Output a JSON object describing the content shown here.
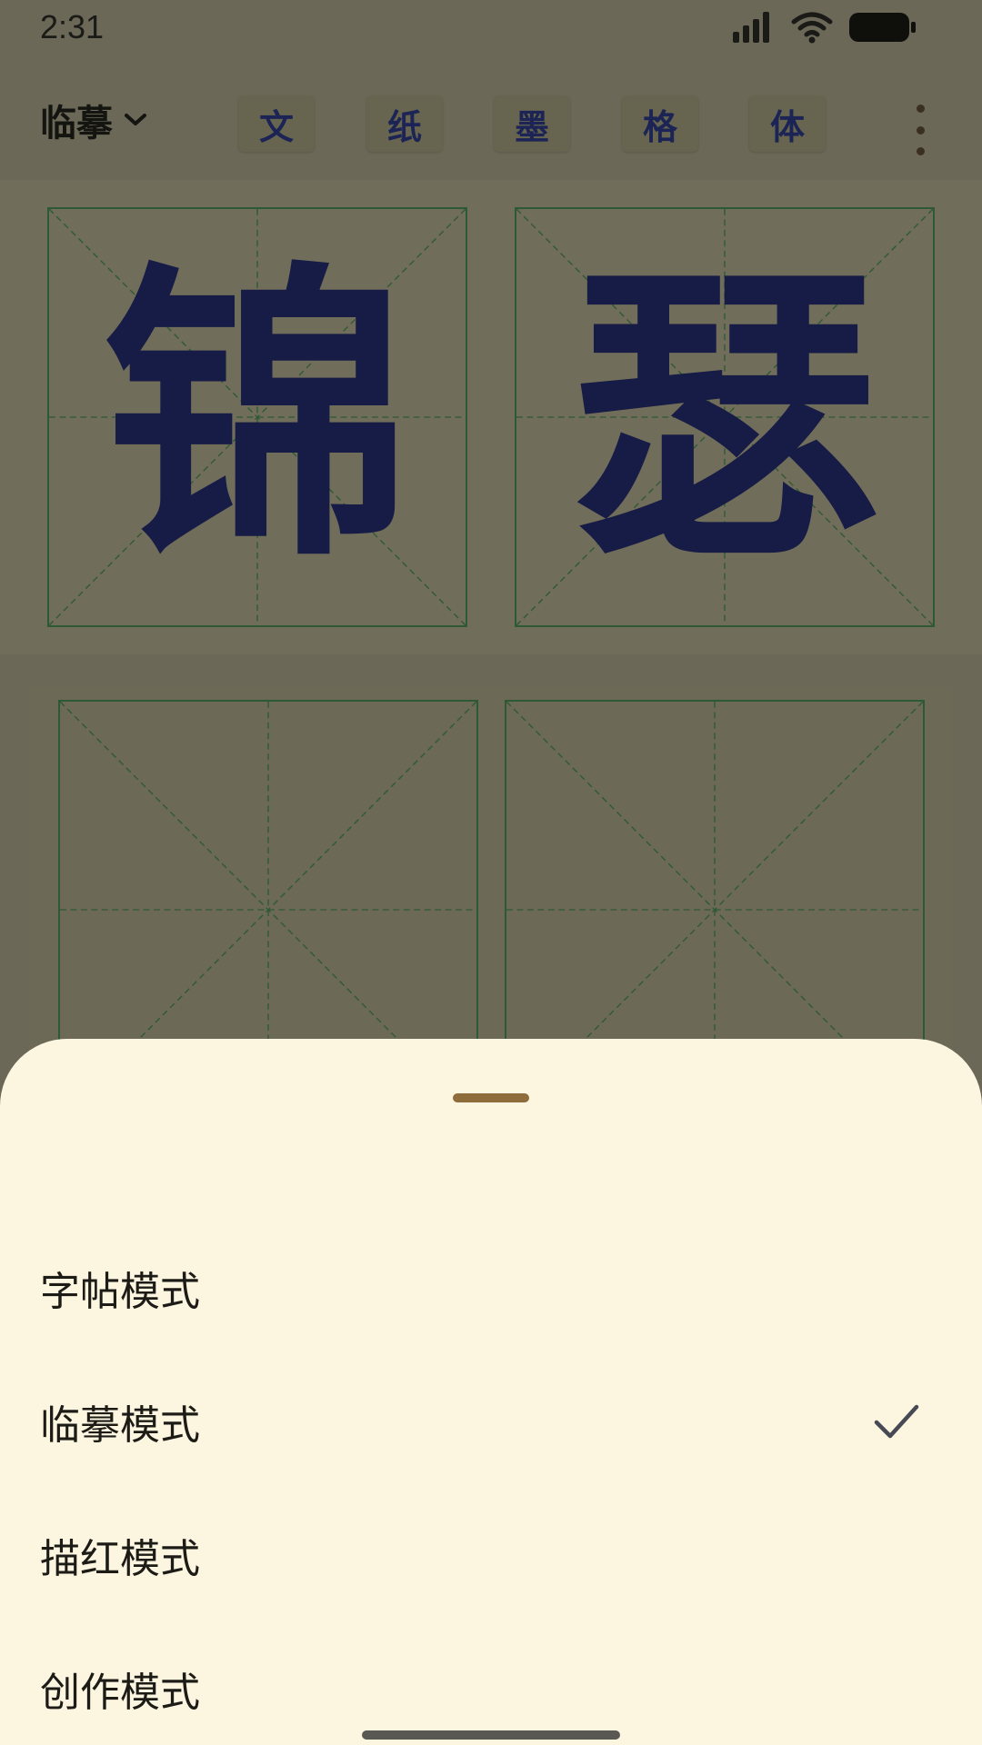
{
  "status_bar": {
    "time": "2:31"
  },
  "toolbar": {
    "mode_label": "临摹",
    "tools": [
      "文",
      "纸",
      "墨",
      "格",
      "体"
    ]
  },
  "reference": {
    "characters": [
      "锦",
      "瑟"
    ]
  },
  "sheet": {
    "items": [
      {
        "label": "字帖模式",
        "selected": false
      },
      {
        "label": "临摹模式",
        "selected": true
      },
      {
        "label": "描红模式",
        "selected": false
      },
      {
        "label": "创作模式",
        "selected": false
      }
    ]
  },
  "colors": {
    "grid_line": "#2e5a33",
    "glyph_ink": "#161c45",
    "sheet_bg": "#fcf5e0",
    "handle": "#8f6c3c"
  }
}
